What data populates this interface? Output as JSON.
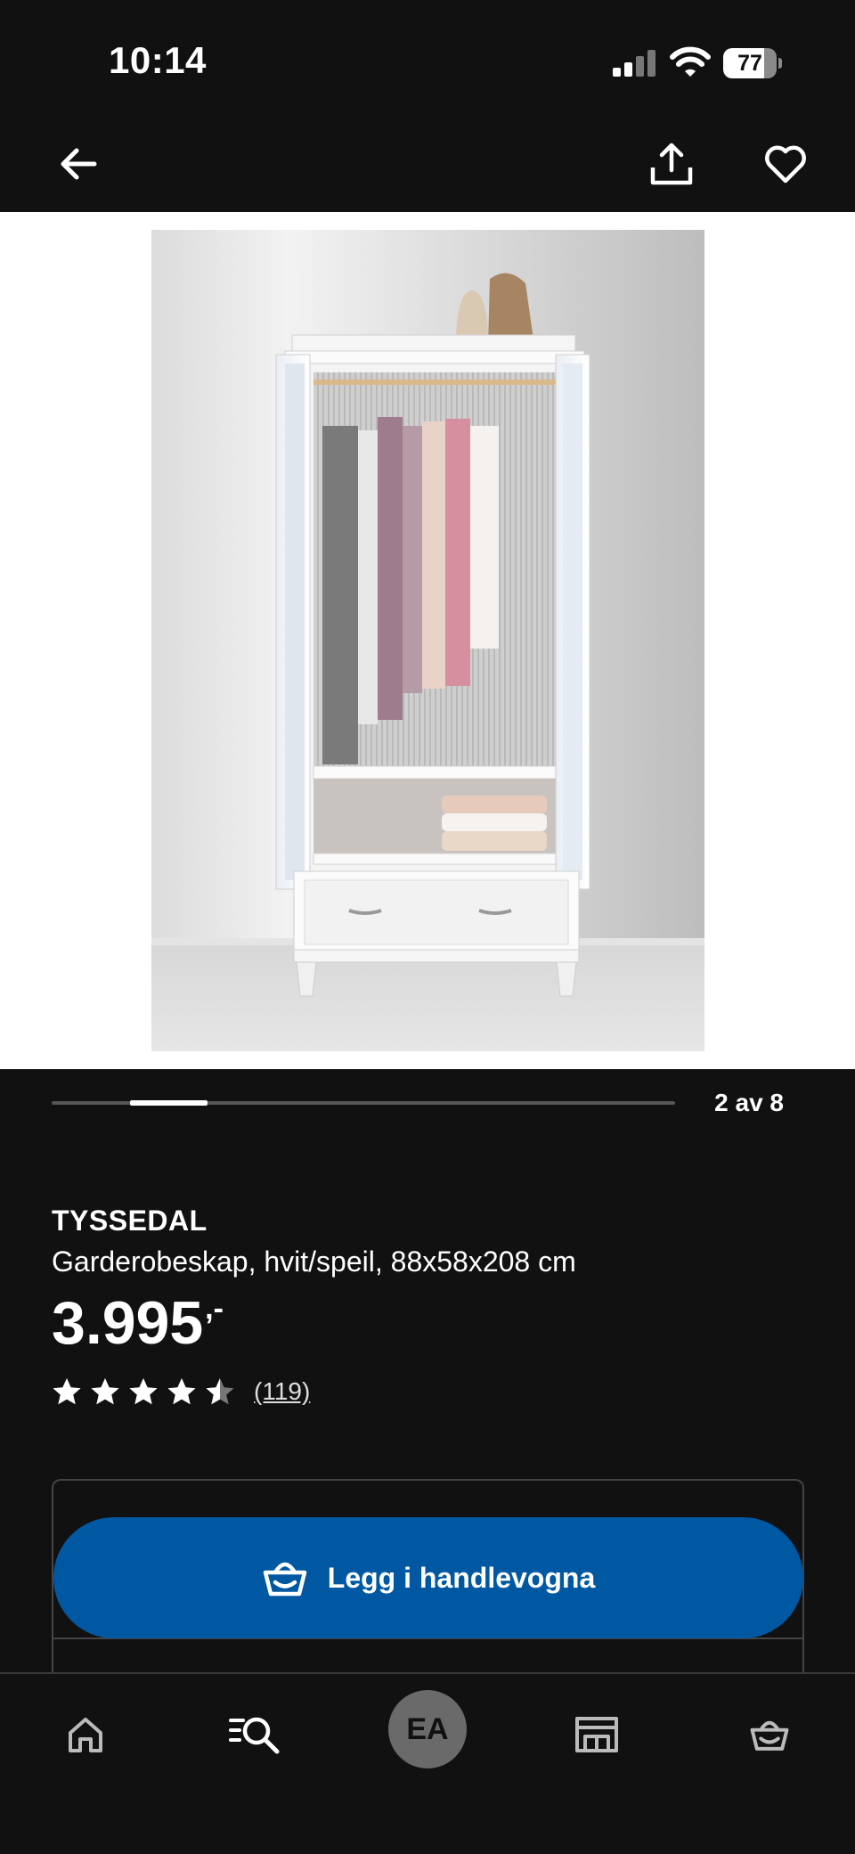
{
  "status_bar": {
    "time": "10:14",
    "battery": "77",
    "battery_level": 0.77,
    "signal_bars_active": 2,
    "signal_bars_total": 4
  },
  "nav": {
    "back_icon": "arrow-left-icon",
    "share_icon": "share-icon",
    "favorite_icon": "heart-icon"
  },
  "carousel": {
    "current": 2,
    "total": 8,
    "counter": "2 av 8"
  },
  "product": {
    "name": "TYSSEDAL",
    "description": "Garderobeskap, hvit/speil, 88x58x208 cm",
    "price": "3.995",
    "price_suffix": ",-",
    "rating": 4.5,
    "rating_max": 5,
    "review_count": "(119)"
  },
  "cart_button": {
    "label": "Legg i handlevogna",
    "icon": "basket-icon"
  },
  "tab_bar": {
    "items": [
      {
        "icon": "home-icon"
      },
      {
        "icon": "search-icon"
      },
      {
        "label": "EA",
        "icon": "avatar"
      },
      {
        "icon": "store-icon"
      },
      {
        "icon": "basket-icon"
      }
    ]
  },
  "colors": {
    "background": "#111111",
    "accent_blue": "#0058a3",
    "text": "#ffffff"
  }
}
